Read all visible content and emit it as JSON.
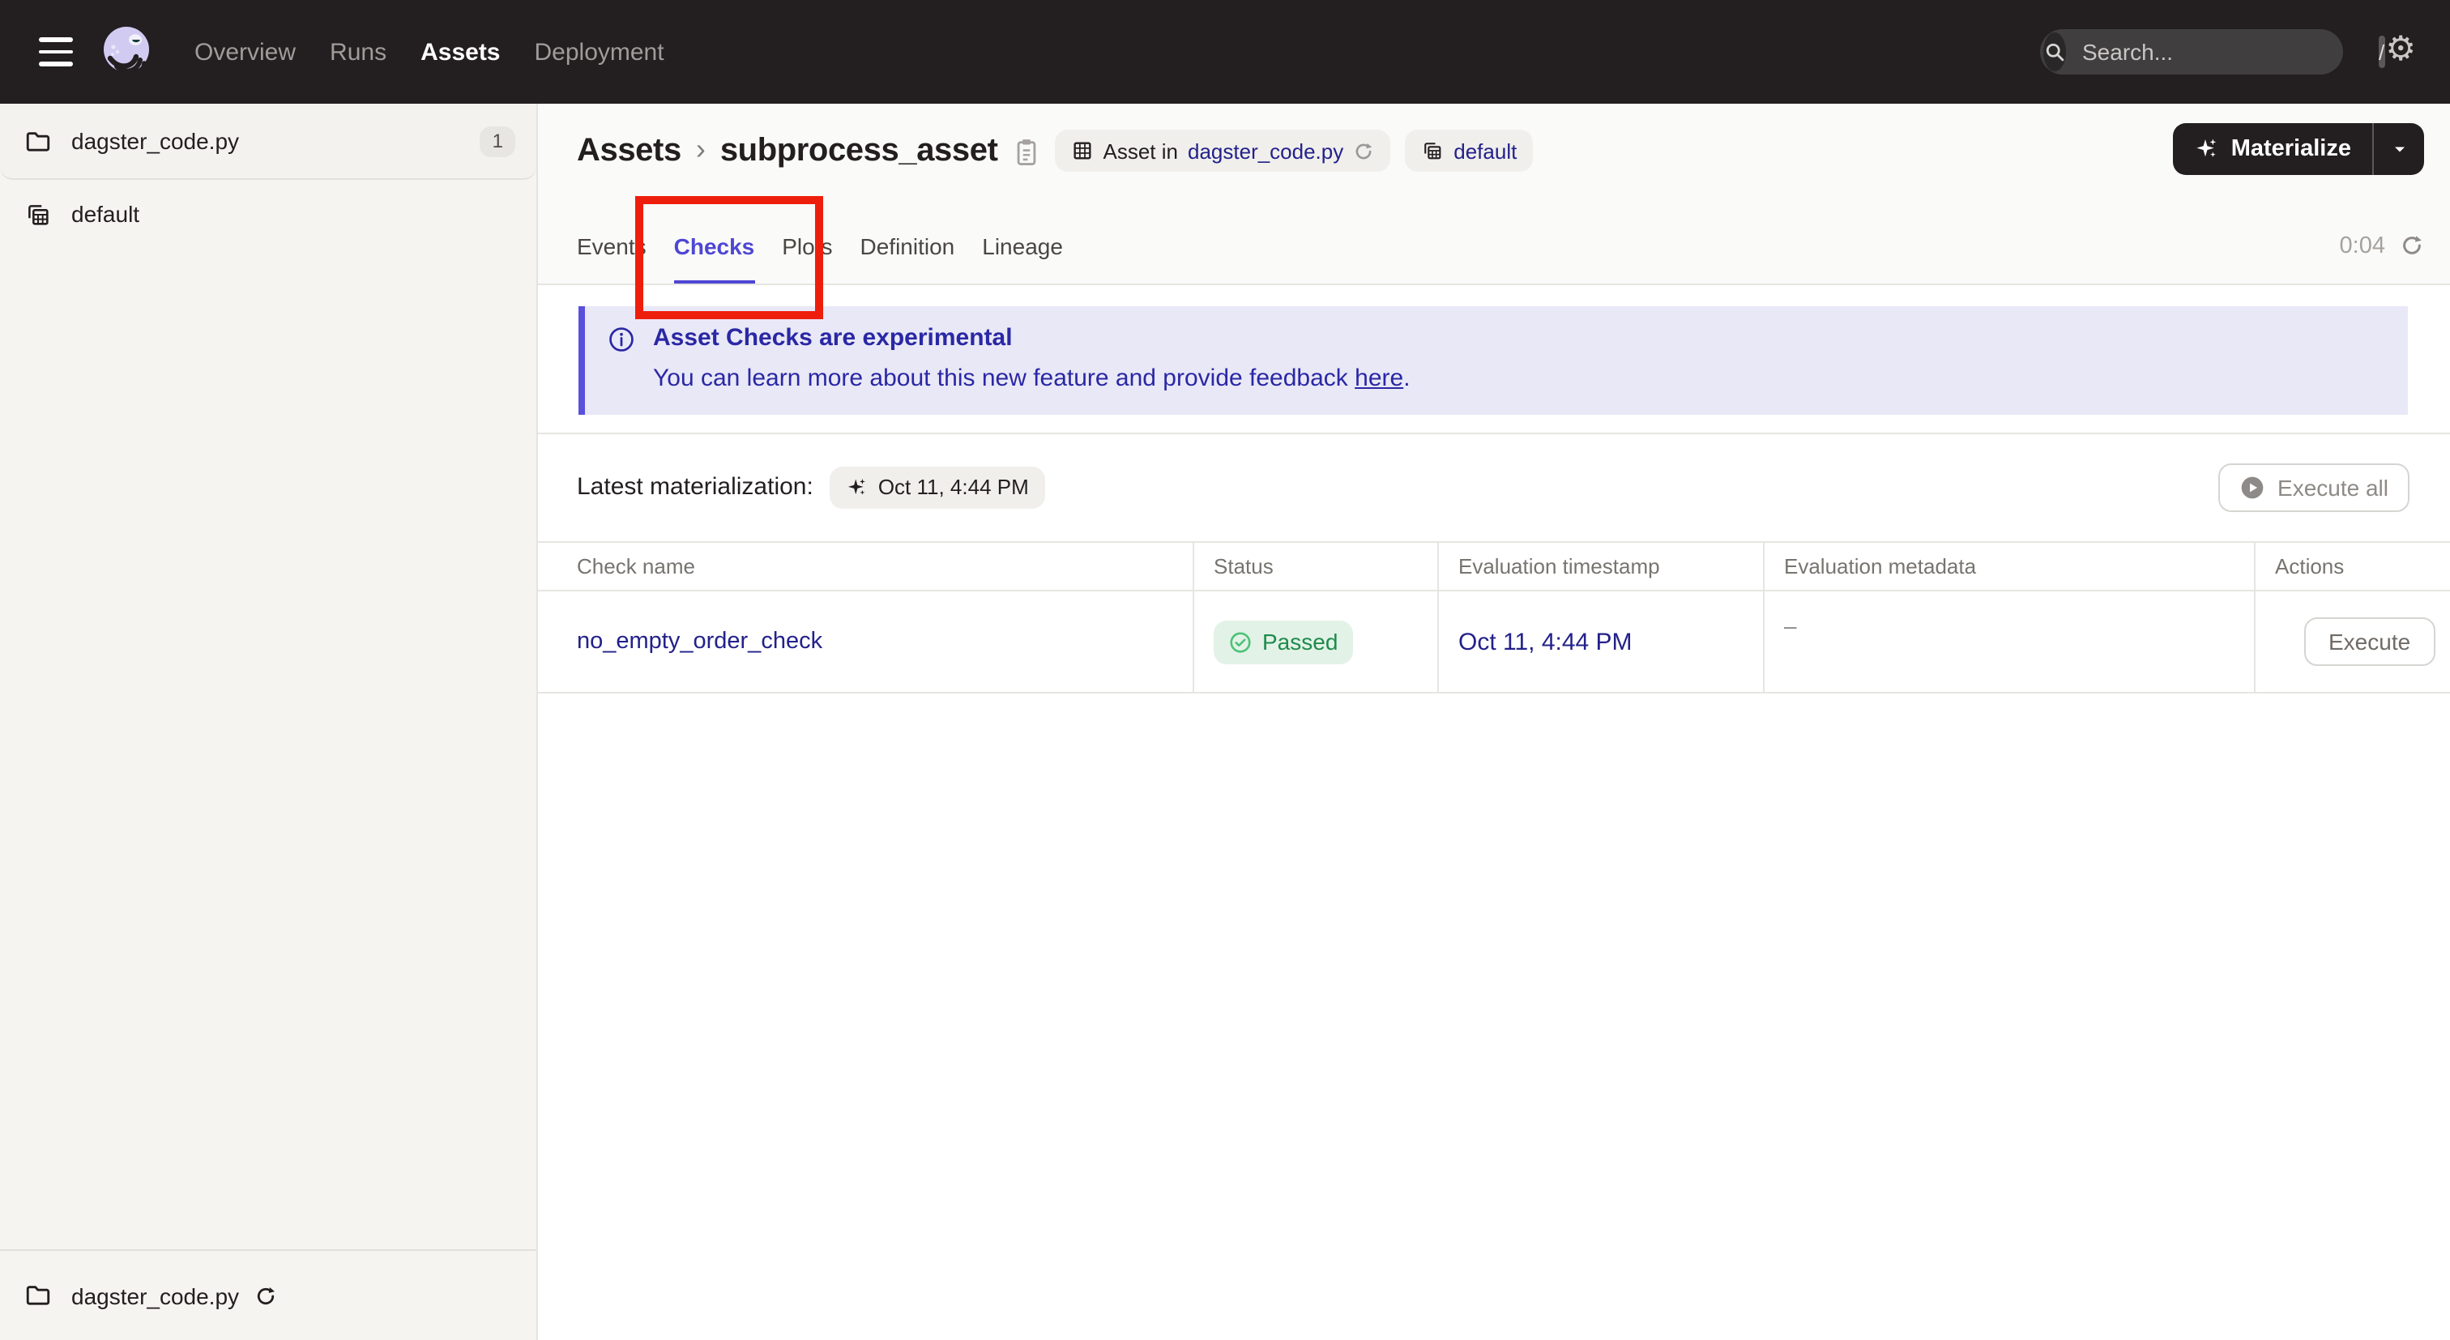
{
  "colors": {
    "navbar_bg": "#231e20",
    "accent_indigo": "#4e46d4",
    "banner_bg": "#e9e8f7",
    "banner_text": "#2a28a4",
    "link_navy": "#23218a",
    "status_green": "#1d8b4c",
    "status_green_bg": "#e3f2e7",
    "annotation_red": "#ee1e0c"
  },
  "navbar": {
    "links": [
      {
        "label": "Overview",
        "active": false
      },
      {
        "label": "Runs",
        "active": false
      },
      {
        "label": "Assets",
        "active": true
      },
      {
        "label": "Deployment",
        "active": false
      }
    ],
    "search_placeholder": "Search...",
    "search_shortcut": "/"
  },
  "sidebar": {
    "items": [
      {
        "label": "dagster_code.py",
        "count": "1",
        "icon": "folder"
      },
      {
        "label": "default",
        "icon": "asset-group"
      }
    ],
    "bottom_item": {
      "label": "dagster_code.py",
      "icon": "folder"
    }
  },
  "header": {
    "breadcrumb_root": "Assets",
    "breadcrumb_sep": "›",
    "asset_name": "subprocess_asset",
    "asset_tag": {
      "prefix": "Asset in",
      "link": "dagster_code.py"
    },
    "group_tag": {
      "label": "default"
    },
    "materialize": {
      "label": "Materialize"
    }
  },
  "tabs": {
    "items": [
      {
        "label": "Events",
        "active": false
      },
      {
        "label": "Checks",
        "active": true
      },
      {
        "label": "Plots",
        "active": false
      },
      {
        "label": "Definition",
        "active": false
      },
      {
        "label": "Lineage",
        "active": false
      }
    ],
    "timer": "0:04"
  },
  "banner": {
    "title": "Asset Checks are experimental",
    "body": "You can learn more about this new feature and provide feedback ",
    "link_text": "here",
    "period": "."
  },
  "materialization": {
    "label": "Latest materialization:",
    "timestamp": "Oct 11, 4:44 PM",
    "execute_all": "Execute all"
  },
  "table": {
    "columns": [
      "Check name",
      "Status",
      "Evaluation timestamp",
      "Evaluation metadata",
      "Actions"
    ],
    "rows": [
      {
        "name": "no_empty_order_check",
        "status": "Passed",
        "timestamp": "Oct 11, 4:44 PM",
        "metadata": "–",
        "action": "Execute"
      }
    ]
  }
}
